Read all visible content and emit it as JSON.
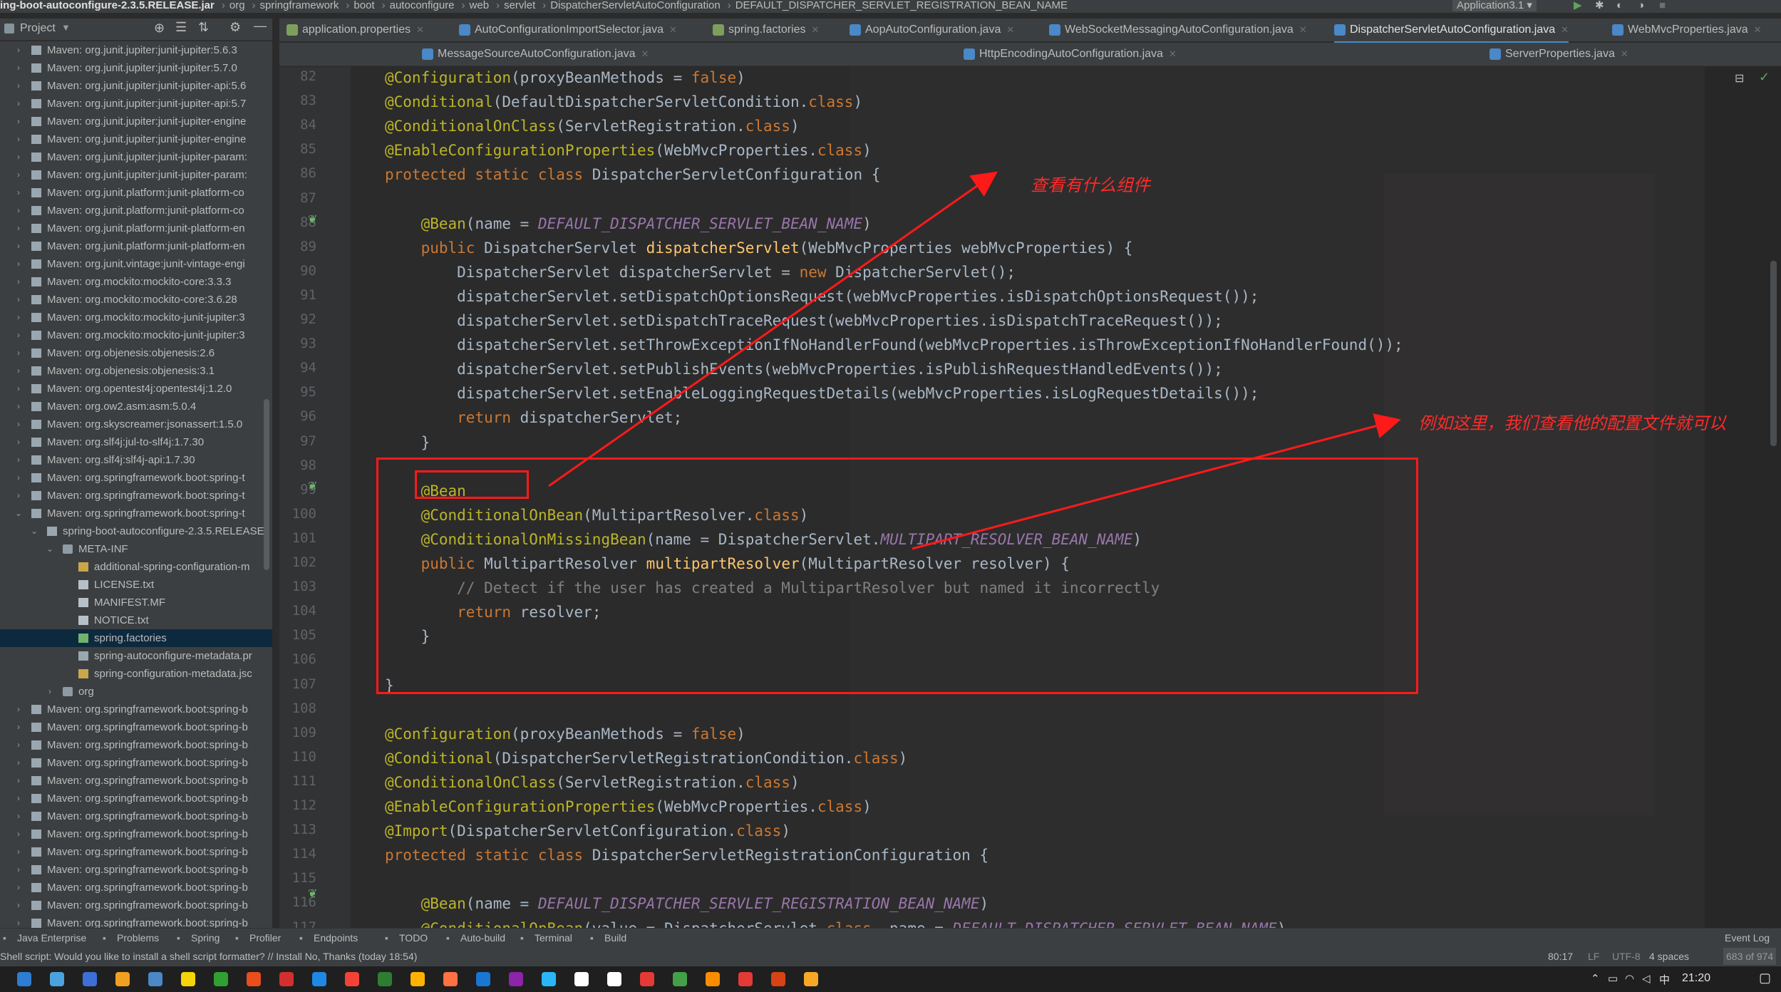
{
  "breadcrumb": {
    "jar": "ing-boot-autoconfigure-2.3.5.RELEASE.jar",
    "items": [
      "org",
      "springframework",
      "boot",
      "autoconfigure",
      "web",
      "servlet",
      "DispatcherServletAutoConfiguration",
      "DEFAULT_DISPATCHER_SERVLET_REGISTRATION_BEAN_NAME"
    ],
    "run_config": "Application3.1"
  },
  "project_panel": {
    "title": "Project"
  },
  "tabs_row1": [
    {
      "label": "application.properties",
      "color": "#7e9f5c"
    },
    {
      "label": "AutoConfigurationImportSelector.java",
      "color": "#4a88c7"
    },
    {
      "label": "spring.factories",
      "color": "#7e9f5c"
    },
    {
      "label": "AopAutoConfiguration.java",
      "color": "#4a88c7"
    },
    {
      "label": "WebSocketMessagingAutoConfiguration.java",
      "color": "#4a88c7"
    },
    {
      "label": "DispatcherServletAutoConfiguration.java",
      "color": "#4a88c7",
      "active": true
    },
    {
      "label": "WebMvcProperties.java",
      "color": "#4a88c7"
    }
  ],
  "tabs_row2": [
    {
      "label": "MessageSourceAutoConfiguration.java",
      "color": "#4a88c7"
    },
    {
      "label": "HttpEncodingAutoConfiguration.java",
      "color": "#4a88c7"
    },
    {
      "label": "ServerProperties.java",
      "color": "#4a88c7"
    }
  ],
  "tree": [
    {
      "label": "Maven: org.junit.jupiter:junit-jupiter:5.6.3",
      "indent": 0,
      "type": "lib",
      "arrow": "right"
    },
    {
      "label": "Maven: org.junit.jupiter:junit-jupiter:5.7.0",
      "indent": 0,
      "type": "lib",
      "arrow": "right"
    },
    {
      "label": "Maven: org.junit.jupiter:junit-jupiter-api:5.6",
      "indent": 0,
      "type": "lib",
      "arrow": "right"
    },
    {
      "label": "Maven: org.junit.jupiter:junit-jupiter-api:5.7",
      "indent": 0,
      "type": "lib",
      "arrow": "right"
    },
    {
      "label": "Maven: org.junit.jupiter:junit-jupiter-engine",
      "indent": 0,
      "type": "lib",
      "arrow": "right"
    },
    {
      "label": "Maven: org.junit.jupiter:junit-jupiter-engine",
      "indent": 0,
      "type": "lib",
      "arrow": "right"
    },
    {
      "label": "Maven: org.junit.jupiter:junit-jupiter-param:",
      "indent": 0,
      "type": "lib",
      "arrow": "right"
    },
    {
      "label": "Maven: org.junit.jupiter:junit-jupiter-param:",
      "indent": 0,
      "type": "lib",
      "arrow": "right"
    },
    {
      "label": "Maven: org.junit.platform:junit-platform-co",
      "indent": 0,
      "type": "lib",
      "arrow": "right"
    },
    {
      "label": "Maven: org.junit.platform:junit-platform-co",
      "indent": 0,
      "type": "lib",
      "arrow": "right"
    },
    {
      "label": "Maven: org.junit.platform:junit-platform-en",
      "indent": 0,
      "type": "lib",
      "arrow": "right"
    },
    {
      "label": "Maven: org.junit.platform:junit-platform-en",
      "indent": 0,
      "type": "lib",
      "arrow": "right"
    },
    {
      "label": "Maven: org.junit.vintage:junit-vintage-engi",
      "indent": 0,
      "type": "lib",
      "arrow": "right"
    },
    {
      "label": "Maven: org.mockito:mockito-core:3.3.3",
      "indent": 0,
      "type": "lib",
      "arrow": "right"
    },
    {
      "label": "Maven: org.mockito:mockito-core:3.6.28",
      "indent": 0,
      "type": "lib",
      "arrow": "right"
    },
    {
      "label": "Maven: org.mockito:mockito-junit-jupiter:3",
      "indent": 0,
      "type": "lib",
      "arrow": "right"
    },
    {
      "label": "Maven: org.mockito:mockito-junit-jupiter:3",
      "indent": 0,
      "type": "lib",
      "arrow": "right"
    },
    {
      "label": "Maven: org.objenesis:objenesis:2.6",
      "indent": 0,
      "type": "lib",
      "arrow": "right"
    },
    {
      "label": "Maven: org.objenesis:objenesis:3.1",
      "indent": 0,
      "type": "lib",
      "arrow": "right"
    },
    {
      "label": "Maven: org.opentest4j:opentest4j:1.2.0",
      "indent": 0,
      "type": "lib",
      "arrow": "right"
    },
    {
      "label": "Maven: org.ow2.asm:asm:5.0.4",
      "indent": 0,
      "type": "lib",
      "arrow": "right"
    },
    {
      "label": "Maven: org.skyscreamer:jsonassert:1.5.0",
      "indent": 0,
      "type": "lib",
      "arrow": "right"
    },
    {
      "label": "Maven: org.slf4j:jul-to-slf4j:1.7.30",
      "indent": 0,
      "type": "lib",
      "arrow": "right"
    },
    {
      "label": "Maven: org.slf4j:slf4j-api:1.7.30",
      "indent": 0,
      "type": "lib",
      "arrow": "right"
    },
    {
      "label": "Maven: org.springframework.boot:spring-t",
      "indent": 0,
      "type": "lib",
      "arrow": "right"
    },
    {
      "label": "Maven: org.springframework.boot:spring-t",
      "indent": 0,
      "type": "lib",
      "arrow": "right"
    },
    {
      "label": "Maven: org.springframework.boot:spring-t",
      "indent": 0,
      "type": "lib",
      "arrow": "down"
    },
    {
      "label": "spring-boot-autoconfigure-2.3.5.RELEASE",
      "indent": 1,
      "type": "jar",
      "arrow": "down"
    },
    {
      "label": "META-INF",
      "indent": 2,
      "type": "folder",
      "arrow": "down"
    },
    {
      "label": "additional-spring-configuration-m",
      "indent": 3,
      "type": "json",
      "arrow": ""
    },
    {
      "label": "LICENSE.txt",
      "indent": 3,
      "type": "txt",
      "arrow": ""
    },
    {
      "label": "MANIFEST.MF",
      "indent": 3,
      "type": "txt",
      "arrow": ""
    },
    {
      "label": "NOTICE.txt",
      "indent": 3,
      "type": "txt",
      "arrow": ""
    },
    {
      "label": "spring.factories",
      "indent": 3,
      "type": "spring",
      "arrow": "",
      "selected": true
    },
    {
      "label": "spring-autoconfigure-metadata.pr",
      "indent": 3,
      "type": "props",
      "arrow": ""
    },
    {
      "label": "spring-configuration-metadata.jsc",
      "indent": 3,
      "type": "json",
      "arrow": ""
    },
    {
      "label": "org",
      "indent": 2,
      "type": "folder",
      "arrow": "right"
    },
    {
      "label": "Maven: org.springframework.boot:spring-b",
      "indent": 0,
      "type": "lib",
      "arrow": "right"
    },
    {
      "label": "Maven: org.springframework.boot:spring-b",
      "indent": 0,
      "type": "lib",
      "arrow": "right"
    },
    {
      "label": "Maven: org.springframework.boot:spring-b",
      "indent": 0,
      "type": "lib",
      "arrow": "right"
    },
    {
      "label": "Maven: org.springframework.boot:spring-b",
      "indent": 0,
      "type": "lib",
      "arrow": "right"
    },
    {
      "label": "Maven: org.springframework.boot:spring-b",
      "indent": 0,
      "type": "lib",
      "arrow": "right"
    },
    {
      "label": "Maven: org.springframework.boot:spring-b",
      "indent": 0,
      "type": "lib",
      "arrow": "right"
    },
    {
      "label": "Maven: org.springframework.boot:spring-b",
      "indent": 0,
      "type": "lib",
      "arrow": "right"
    },
    {
      "label": "Maven: org.springframework.boot:spring-b",
      "indent": 0,
      "type": "lib",
      "arrow": "right"
    },
    {
      "label": "Maven: org.springframework.boot:spring-b",
      "indent": 0,
      "type": "lib",
      "arrow": "right"
    },
    {
      "label": "Maven: org.springframework.boot:spring-b",
      "indent": 0,
      "type": "lib",
      "arrow": "right"
    },
    {
      "label": "Maven: org.springframework.boot:spring-b",
      "indent": 0,
      "type": "lib",
      "arrow": "right"
    },
    {
      "label": "Maven: org.springframework.boot:spring-b",
      "indent": 0,
      "type": "lib",
      "arrow": "right"
    },
    {
      "label": "Maven: org.springframework.boot:spring-b",
      "indent": 0,
      "type": "lib",
      "arrow": "right"
    },
    {
      "label": "Maven: org.springframework.boot:spring-b",
      "indent": 0,
      "type": "lib",
      "arrow": "right"
    }
  ],
  "code_lines": [
    {
      "n": "82",
      "parts": [
        [
          "an",
          "@Configuration"
        ],
        [
          "",
          "(proxyBeanMethods = "
        ],
        [
          "kw",
          "false"
        ],
        [
          "",
          ")"
        ]
      ]
    },
    {
      "n": "83",
      "parts": [
        [
          "an",
          "@Conditional"
        ],
        [
          "",
          "(DefaultDispatcherServletCondition."
        ],
        [
          "kw",
          "class"
        ],
        [
          "",
          ")"
        ]
      ]
    },
    {
      "n": "84",
      "parts": [
        [
          "an",
          "@ConditionalOnClass"
        ],
        [
          "",
          "(ServletRegistration."
        ],
        [
          "kw",
          "class"
        ],
        [
          "",
          ")"
        ]
      ]
    },
    {
      "n": "85",
      "parts": [
        [
          "an",
          "@EnableConfigurationProperties"
        ],
        [
          "",
          "(WebMvcProperties."
        ],
        [
          "kw",
          "class"
        ],
        [
          "",
          ")"
        ]
      ]
    },
    {
      "n": "86",
      "parts": [
        [
          "kw",
          "protected static class "
        ],
        [
          "",
          "DispatcherServletConfiguration {"
        ]
      ]
    },
    {
      "n": "87",
      "parts": []
    },
    {
      "n": "88",
      "parts": [
        [
          "",
          "    "
        ],
        [
          "an",
          "@Bean"
        ],
        [
          "",
          "(name = "
        ],
        [
          "it",
          "DEFAULT_DISPATCHER_SERVLET_BEAN_NAME"
        ],
        [
          "",
          ")"
        ]
      ]
    },
    {
      "n": "89",
      "parts": [
        [
          "",
          "    "
        ],
        [
          "kw",
          "public "
        ],
        [
          "",
          "DispatcherServlet "
        ],
        [
          "fn",
          "dispatcherServlet"
        ],
        [
          "",
          "(WebMvcProperties webMvcProperties) {"
        ]
      ]
    },
    {
      "n": "90",
      "parts": [
        [
          "",
          "        DispatcherServlet dispatcherServlet = "
        ],
        [
          "kw",
          "new "
        ],
        [
          "",
          "DispatcherServlet();"
        ]
      ]
    },
    {
      "n": "91",
      "parts": [
        [
          "",
          "        dispatcherServlet.setDispatchOptionsRequest(webMvcProperties.isDispatchOptionsRequest());"
        ]
      ]
    },
    {
      "n": "92",
      "parts": [
        [
          "",
          "        dispatcherServlet.setDispatchTraceRequest(webMvcProperties.isDispatchTraceRequest());"
        ]
      ]
    },
    {
      "n": "93",
      "parts": [
        [
          "",
          "        dispatcherServlet.setThrowExceptionIfNoHandlerFound(webMvcProperties.isThrowExceptionIfNoHandlerFound());"
        ]
      ]
    },
    {
      "n": "94",
      "parts": [
        [
          "",
          "        dispatcherServlet.setPublishEvents(webMvcProperties.isPublishRequestHandledEvents());"
        ]
      ]
    },
    {
      "n": "95",
      "parts": [
        [
          "",
          "        dispatcherServlet.setEnableLoggingRequestDetails(webMvcProperties.isLogRequestDetails());"
        ]
      ]
    },
    {
      "n": "96",
      "parts": [
        [
          "",
          "        "
        ],
        [
          "kw",
          "return "
        ],
        [
          "",
          "dispatcherServlet;"
        ]
      ]
    },
    {
      "n": "97",
      "parts": [
        [
          "",
          "    }"
        ]
      ]
    },
    {
      "n": "98",
      "parts": []
    },
    {
      "n": "99",
      "parts": [
        [
          "",
          "    "
        ],
        [
          "an",
          "@Bean"
        ]
      ]
    },
    {
      "n": "100",
      "parts": [
        [
          "",
          "    "
        ],
        [
          "an",
          "@ConditionalOnBean"
        ],
        [
          "",
          "(MultipartResolver."
        ],
        [
          "kw",
          "class"
        ],
        [
          "",
          ")"
        ]
      ]
    },
    {
      "n": "101",
      "parts": [
        [
          "",
          "    "
        ],
        [
          "an",
          "@ConditionalOnMissingBean"
        ],
        [
          "",
          "(name = DispatcherServlet."
        ],
        [
          "it",
          "MULTIPART_RESOLVER_BEAN_NAME"
        ],
        [
          "",
          ")"
        ]
      ]
    },
    {
      "n": "102",
      "parts": [
        [
          "",
          "    "
        ],
        [
          "kw",
          "public "
        ],
        [
          "",
          "MultipartResolver "
        ],
        [
          "fn",
          "multipartResolver"
        ],
        [
          "",
          "(MultipartResolver resolver) {"
        ]
      ]
    },
    {
      "n": "103",
      "parts": [
        [
          "",
          "        "
        ],
        [
          "cm",
          "// Detect if the user has created a MultipartResolver but named it incorrectly"
        ]
      ]
    },
    {
      "n": "104",
      "parts": [
        [
          "",
          "        "
        ],
        [
          "kw",
          "return "
        ],
        [
          "",
          "resolver;"
        ]
      ]
    },
    {
      "n": "105",
      "parts": [
        [
          "",
          "    }"
        ]
      ]
    },
    {
      "n": "106",
      "parts": []
    },
    {
      "n": "107",
      "parts": [
        [
          "",
          "}"
        ]
      ]
    },
    {
      "n": "108",
      "parts": []
    },
    {
      "n": "109",
      "parts": [
        [
          "an",
          "@Configuration"
        ],
        [
          "",
          "(proxyBeanMethods = "
        ],
        [
          "kw",
          "false"
        ],
        [
          "",
          ")"
        ]
      ]
    },
    {
      "n": "110",
      "parts": [
        [
          "an",
          "@Conditional"
        ],
        [
          "",
          "(DispatcherServletRegistrationCondition."
        ],
        [
          "kw",
          "class"
        ],
        [
          "",
          ")"
        ]
      ]
    },
    {
      "n": "111",
      "parts": [
        [
          "an",
          "@ConditionalOnClass"
        ],
        [
          "",
          "(ServletRegistration."
        ],
        [
          "kw",
          "class"
        ],
        [
          "",
          ")"
        ]
      ]
    },
    {
      "n": "112",
      "parts": [
        [
          "an",
          "@EnableConfigurationProperties"
        ],
        [
          "",
          "(WebMvcProperties."
        ],
        [
          "kw",
          "class"
        ],
        [
          "",
          ")"
        ]
      ]
    },
    {
      "n": "113",
      "parts": [
        [
          "an",
          "@Import"
        ],
        [
          "",
          "(DispatcherServletConfiguration."
        ],
        [
          "kw",
          "class"
        ],
        [
          "",
          ")"
        ]
      ]
    },
    {
      "n": "114",
      "parts": [
        [
          "kw",
          "protected static class "
        ],
        [
          "",
          "DispatcherServletRegistrationConfiguration {"
        ]
      ]
    },
    {
      "n": "115",
      "parts": []
    },
    {
      "n": "116",
      "parts": [
        [
          "",
          "    "
        ],
        [
          "an",
          "@Bean"
        ],
        [
          "",
          "(name = "
        ],
        [
          "it",
          "DEFAULT_DISPATCHER_SERVLET_REGISTRATION_BEAN_NAME"
        ],
        [
          "",
          ")"
        ]
      ]
    },
    {
      "n": "117",
      "parts": [
        [
          "",
          "    "
        ],
        [
          "an",
          "@ConditionalOnBean"
        ],
        [
          "",
          "(value = DispatcherServlet."
        ],
        [
          "kw",
          "class"
        ],
        [
          "",
          ", name = "
        ],
        [
          "it",
          "DEFAULT_DISPATCHER_SERVLET_BEAN_NAME"
        ],
        [
          "",
          ")"
        ]
      ]
    }
  ],
  "annotations": {
    "note1": "查看有什么组件",
    "note2": "例如这里，我们查看他的配置文件就可以"
  },
  "tool_windows": [
    "Java Enterprise",
    "Problems",
    "Spring",
    "Profiler",
    "Endpoints",
    "TODO",
    "Auto-build",
    "Terminal",
    "Build"
  ],
  "event_log": "Event Log",
  "status": {
    "message": "Shell script: Would you like to install a shell script formatter? // Install   No, Thanks (today 18:54)",
    "position": "80:17",
    "line_sep": "LF",
    "encoding": "UTF-8",
    "indent": "4 spaces",
    "memory": "683 of 974"
  },
  "taskbar": {
    "time": "21:20"
  },
  "colors": {
    "accent": "#4a88c7",
    "annotation_red": "#ff1a1a",
    "selection": "#0d293e"
  }
}
